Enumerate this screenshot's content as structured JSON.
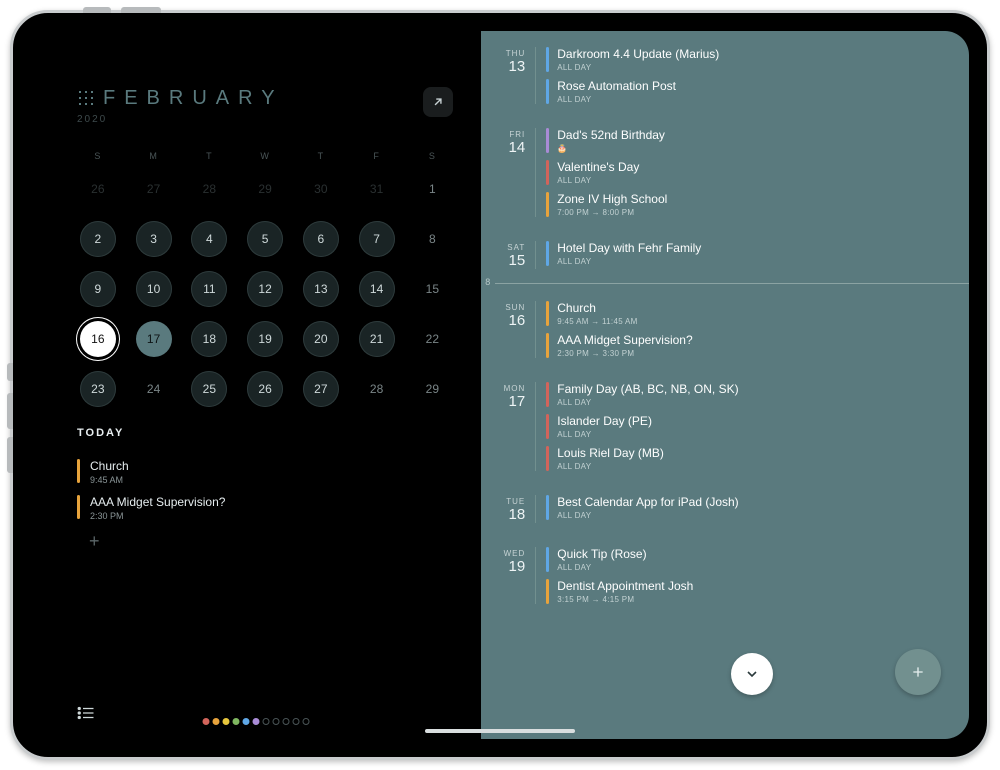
{
  "month": {
    "name": "FEBRUARY",
    "year": "2020"
  },
  "dow": [
    "S",
    "M",
    "T",
    "W",
    "T",
    "F",
    "S"
  ],
  "calendar": {
    "rows": [
      [
        {
          "n": "26",
          "style": "other"
        },
        {
          "n": "27",
          "style": "other"
        },
        {
          "n": "28",
          "style": "other"
        },
        {
          "n": "29",
          "style": "other"
        },
        {
          "n": "30",
          "style": "other"
        },
        {
          "n": "31",
          "style": "other"
        },
        {
          "n": "1",
          "style": "plain"
        }
      ],
      [
        {
          "n": "2",
          "style": "ring"
        },
        {
          "n": "3",
          "style": "ring"
        },
        {
          "n": "4",
          "style": "ring"
        },
        {
          "n": "5",
          "style": "ring"
        },
        {
          "n": "6",
          "style": "ring"
        },
        {
          "n": "7",
          "style": "ring"
        },
        {
          "n": "8",
          "style": "plain"
        }
      ],
      [
        {
          "n": "9",
          "style": "ring"
        },
        {
          "n": "10",
          "style": "ring"
        },
        {
          "n": "11",
          "style": "ring"
        },
        {
          "n": "12",
          "style": "ring"
        },
        {
          "n": "13",
          "style": "ring"
        },
        {
          "n": "14",
          "style": "ring"
        },
        {
          "n": "15",
          "style": "plain"
        }
      ],
      [
        {
          "n": "16",
          "style": "today"
        },
        {
          "n": "17",
          "style": "sel"
        },
        {
          "n": "18",
          "style": "ring"
        },
        {
          "n": "19",
          "style": "ring"
        },
        {
          "n": "20",
          "style": "ring"
        },
        {
          "n": "21",
          "style": "ring"
        },
        {
          "n": "22",
          "style": "plain"
        }
      ],
      [
        {
          "n": "23",
          "style": "ring"
        },
        {
          "n": "24",
          "style": "plain"
        },
        {
          "n": "25",
          "style": "ring"
        },
        {
          "n": "26",
          "style": "ring"
        },
        {
          "n": "27",
          "style": "ring"
        },
        {
          "n": "28",
          "style": "plain"
        },
        {
          "n": "29",
          "style": "plain"
        }
      ]
    ]
  },
  "today_label": "TODAY",
  "today_events": [
    {
      "title": "Church",
      "sub": "9:45 AM",
      "color": "c-orange"
    },
    {
      "title": "AAA Midget Supervision?",
      "sub": "2:30 PM",
      "color": "c-orange"
    }
  ],
  "tick8": "8",
  "agenda": [
    {
      "wd": "THU",
      "dn": "13",
      "events": [
        {
          "title": "Darkroom 4.4 Update (Marius)",
          "sub": "ALL DAY",
          "color": "c-blue"
        },
        {
          "title": "Rose Automation Post",
          "sub": "ALL DAY",
          "color": "c-blue"
        }
      ]
    },
    {
      "wd": "FRI",
      "dn": "14",
      "events": [
        {
          "title": "Dad's 52nd Birthday",
          "sub": "🎂",
          "color": "c-purple"
        },
        {
          "title": "Valentine's Day",
          "sub": "ALL DAY",
          "color": "c-red"
        },
        {
          "title": "Zone IV High School",
          "sub": "7:00 PM → 8:00 PM",
          "color": "c-orange"
        }
      ]
    },
    {
      "wd": "SAT",
      "dn": "15",
      "events": [
        {
          "title": "Hotel Day with Fehr Family",
          "sub": "ALL DAY",
          "color": "c-blue"
        }
      ]
    },
    {
      "wd": "SUN",
      "dn": "16",
      "events": [
        {
          "title": "Church",
          "sub": "9:45 AM → 11:45 AM",
          "color": "c-orange"
        },
        {
          "title": "AAA Midget Supervision?",
          "sub": "2:30 PM → 3:30 PM",
          "color": "c-orange"
        }
      ]
    },
    {
      "wd": "MON",
      "dn": "17",
      "events": [
        {
          "title": "Family Day (AB, BC, NB, ON, SK)",
          "sub": "ALL DAY",
          "color": "c-red"
        },
        {
          "title": "Islander Day (PE)",
          "sub": "ALL DAY",
          "color": "c-red"
        },
        {
          "title": "Louis Riel Day (MB)",
          "sub": "ALL DAY",
          "color": "c-red"
        }
      ]
    },
    {
      "wd": "TUE",
      "dn": "18",
      "events": [
        {
          "title": "Best Calendar App for iPad (Josh)",
          "sub": "ALL DAY",
          "color": "c-blue"
        }
      ]
    },
    {
      "wd": "WED",
      "dn": "19",
      "events": [
        {
          "title": "Quick Tip (Rose)",
          "sub": "ALL DAY",
          "color": "c-blue"
        },
        {
          "title": "Dentist Appointment Josh",
          "sub": "3:15 PM → 4:15 PM",
          "color": "c-orange"
        }
      ]
    }
  ],
  "dot_colors": [
    "#d2645b",
    "#e7a33c",
    "#e7c63c",
    "#7fb760",
    "#5fa7e6",
    "#a98bd6",
    "#556",
    "#556",
    "#556",
    "#556",
    "#556"
  ]
}
